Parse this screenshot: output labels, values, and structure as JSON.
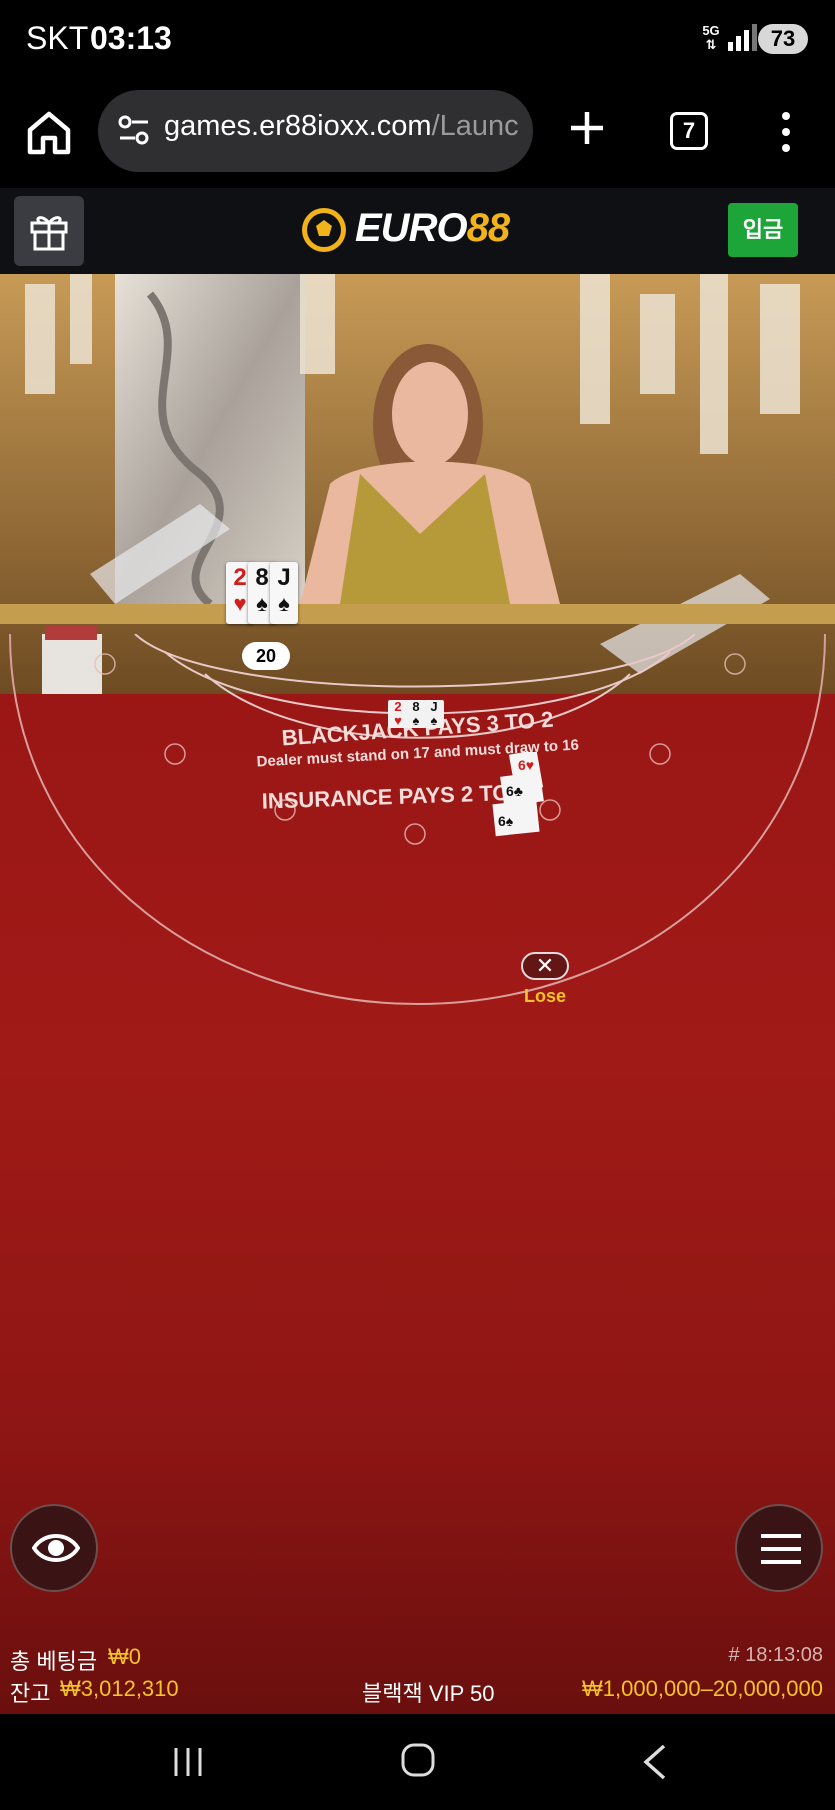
{
  "status_bar": {
    "carrier": "SKT",
    "time": "03:13",
    "network": "5G",
    "battery": "73"
  },
  "browser": {
    "url_domain": "games.er88ioxx.com",
    "url_path": "/Launc",
    "tab_count": "7"
  },
  "site_header": {
    "logo_text_a": "EURO",
    "logo_text_b": "88",
    "deposit_label": "입금"
  },
  "game": {
    "dealer_cards": [
      {
        "rank": "2",
        "suit": "♥",
        "color": "red"
      },
      {
        "rank": "8",
        "suit": "♠",
        "color": "black"
      },
      {
        "rank": "J",
        "suit": "♠",
        "color": "black"
      }
    ],
    "dealer_total": "20",
    "felt_lines": {
      "line1": "BLACKJACK PAYS 3 TO 2",
      "line2": "Dealer must stand on 17 and must draw to 16",
      "line3": "INSURANCE PAYS 2 TO 1"
    },
    "result_icon": "close-icon",
    "result_label": "Lose"
  },
  "info_bar": {
    "total_bet_label": "총 베팅금",
    "total_bet_value": "₩0",
    "balance_label": "잔고",
    "balance_value": "₩3,012,310",
    "round_id": "# 18:13:08",
    "table_name": "블랙잭 VIP 50",
    "bet_limits": "₩1,000,000–20,000,000"
  },
  "colors": {
    "accent_gold": "#f6c22b",
    "deposit_green": "#1da53a",
    "felt_red": "#9a1716"
  }
}
